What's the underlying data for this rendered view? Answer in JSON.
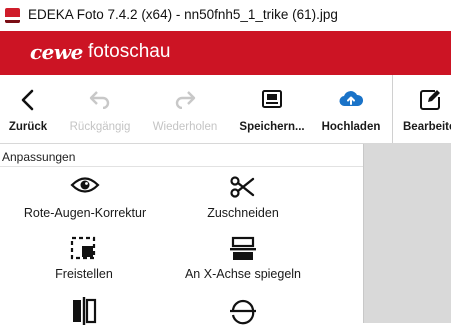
{
  "window": {
    "title": "EDEKA Foto 7.4.2 (x64) - nn50fnh5_1_trike (61).jpg",
    "app_icon": "edeka-app-icon"
  },
  "brand": {
    "logo": "cewe",
    "name": "fotoschau",
    "color": "#cc1424"
  },
  "toolbar": {
    "items": [
      {
        "label": "Zurück",
        "icon": "back-arrow-icon",
        "enabled": true
      },
      {
        "label": "Rückgängig",
        "icon": "undo-icon",
        "enabled": false
      },
      {
        "label": "Wiederholen",
        "icon": "redo-icon",
        "enabled": false
      },
      {
        "label": "Speichern...",
        "icon": "save-icon",
        "enabled": true
      },
      {
        "label": "Hochladen",
        "icon": "cloud-upload-icon",
        "enabled": true
      },
      {
        "label": "Bearbeite",
        "icon": "edit-icon",
        "enabled": true,
        "active": true
      }
    ]
  },
  "panel": {
    "header": "Anpassungen",
    "functions": [
      {
        "label": "Rote-Augen-Korrektur",
        "icon": "eye-icon"
      },
      {
        "label": "Zuschneiden",
        "icon": "scissors-icon"
      },
      {
        "label": "Freistellen",
        "icon": "cutout-icon"
      },
      {
        "label": "An X-Achse spiegeln",
        "icon": "flip-horizontal-axis-icon"
      },
      {
        "label": "",
        "icon": "flip-vertical-axis-icon"
      },
      {
        "label": "",
        "icon": "rotate-icon"
      }
    ]
  }
}
